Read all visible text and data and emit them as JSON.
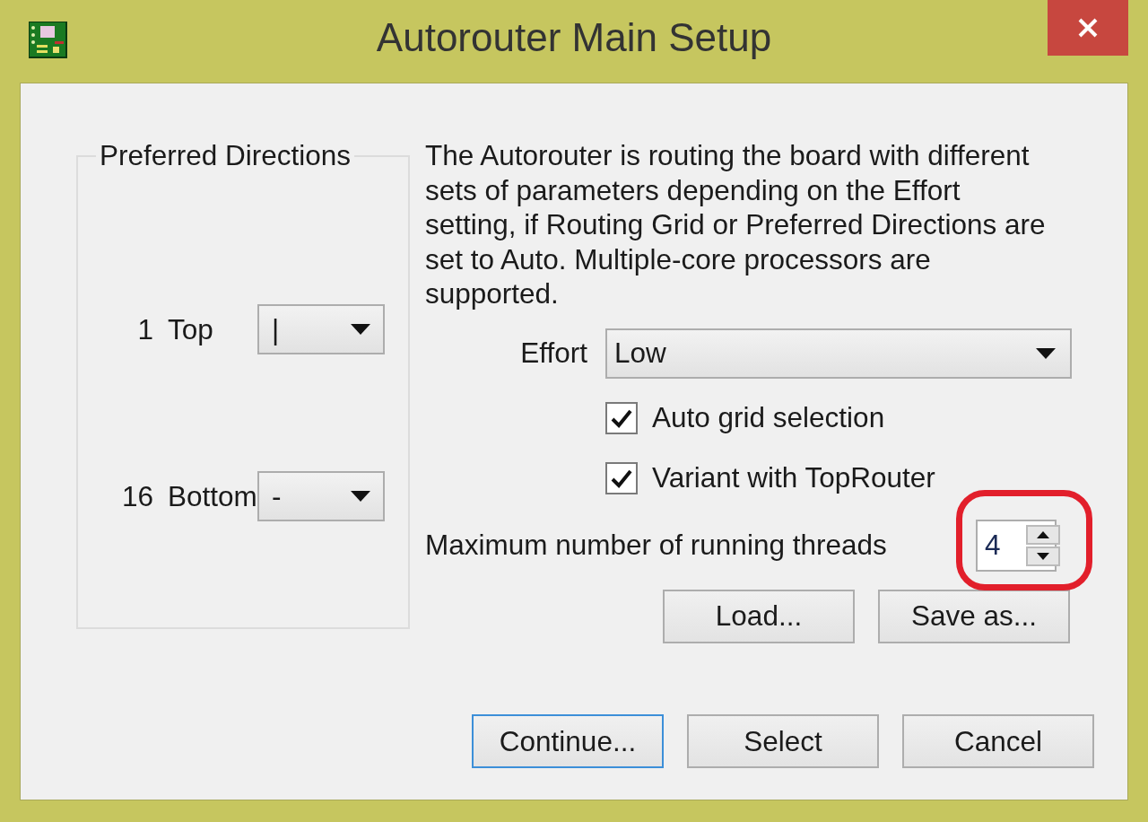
{
  "window": {
    "title": "Autorouter Main Setup"
  },
  "preferred_directions": {
    "title": "Preferred Directions",
    "layers": [
      {
        "number": "1",
        "name": "Top",
        "direction": "|"
      },
      {
        "number": "16",
        "name": "Bottom",
        "direction": "-"
      }
    ]
  },
  "description": "The Autorouter is routing the board with different sets of parameters depending on the Effort setting, if Routing Grid or Preferred Directions are set to Auto. Multiple-core processors are supported.",
  "effort": {
    "label": "Effort",
    "value": "Low"
  },
  "checkboxes": [
    {
      "label": "Auto grid selection",
      "checked": true
    },
    {
      "label": "Variant with TopRouter",
      "checked": true
    }
  ],
  "threads": {
    "label": "Maximum number of running threads",
    "value": "4"
  },
  "file_buttons": [
    "Load...",
    "Save as..."
  ],
  "buttons": [
    {
      "label": "Continue...",
      "default": true
    },
    {
      "label": "Select",
      "default": false
    },
    {
      "label": "Cancel",
      "default": false
    }
  ]
}
